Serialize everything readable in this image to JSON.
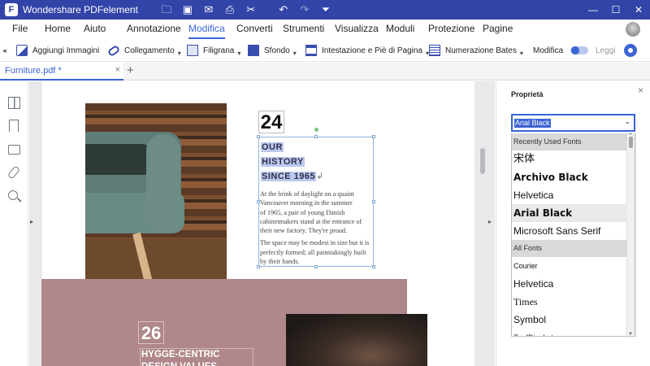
{
  "app": {
    "title": "Wondershare PDFelement",
    "logo_letter": "F"
  },
  "quick_access": [
    "folder-icon",
    "save-icon",
    "mail-icon",
    "print-icon",
    "scissors-icon",
    "undo-icon",
    "redo-icon",
    "customize-icon"
  ],
  "window_controls": {
    "minimize": "—",
    "maximize": "☐",
    "close": "✕"
  },
  "menu": {
    "items": [
      {
        "label": "File"
      },
      {
        "label": "Home"
      },
      {
        "label": "Aiuto"
      },
      {
        "label": "Annotazione"
      },
      {
        "label": "Modifica"
      },
      {
        "label": "Converti"
      },
      {
        "label": "Strumenti"
      },
      {
        "label": "Visualizza"
      },
      {
        "label": "Moduli"
      },
      {
        "label": "Protezione"
      },
      {
        "label": "Pagine"
      }
    ],
    "active": "Modifica"
  },
  "toolbar": {
    "items": [
      {
        "label": "Aggiungi Immagini",
        "icon": "add-image-icon"
      },
      {
        "label": "Collegamento",
        "icon": "link-icon"
      },
      {
        "label": "Filigrana",
        "icon": "watermark-icon"
      },
      {
        "label": "Sfondo",
        "icon": "background-icon"
      },
      {
        "label": "Intestazione e Piè di Pagina",
        "icon": "header-footer-icon"
      },
      {
        "label": "Numerazione Bates",
        "icon": "bates-icon"
      }
    ],
    "mode_edit_label": "Modifica",
    "mode_read_label": "Leggi",
    "caret": "▾"
  },
  "tabs": {
    "document": "Furniture.pdf *",
    "close_glyph": "×",
    "add_glyph": "+"
  },
  "page": {
    "num24": "24",
    "history_lines": [
      "OUR",
      "HISTORY",
      "SINCE 1965"
    ],
    "para1": "At the brink of daylight on a quaint\nVancouver morning in the summer\nof 1965, a pair of young Danish\ncabinetmakers stand at the entrance of\ntheir new factory. They're proud.",
    "para2": "The space may be modest in size but it is\nperfectly formed; all painstakingly built\nby their hands.",
    "num26": "26",
    "hygge": "HYGGE-CENTRIC\nDESIGN VALUES"
  },
  "properties": {
    "title": "Proprietà",
    "close": "×",
    "font_value": "Arial Black",
    "chevron": "⌄",
    "font_list": [
      {
        "label": "Recently Used Fonts",
        "kind": "header"
      },
      {
        "label": "宋体",
        "kind": "font"
      },
      {
        "label": "Archivo Black",
        "kind": "font"
      },
      {
        "label": "Helvetica",
        "kind": "font"
      },
      {
        "label": "Arial Black",
        "kind": "font"
      },
      {
        "label": "Microsoft Sans Serif",
        "kind": "font"
      },
      {
        "label": "All Fonts",
        "kind": "header"
      },
      {
        "label": "Courier",
        "kind": "font"
      },
      {
        "label": "Helvetica",
        "kind": "font"
      },
      {
        "label": "Times",
        "kind": "font"
      },
      {
        "label": "Symbol",
        "kind": "font"
      },
      {
        "label": "ZapfDingbats",
        "kind": "font"
      }
    ],
    "selected_font": "Arial Black"
  },
  "colors": {
    "brand": "#3344a8",
    "accent": "#3b64d4",
    "selection": "#bcc9ee",
    "mauve": "#b0878a"
  }
}
